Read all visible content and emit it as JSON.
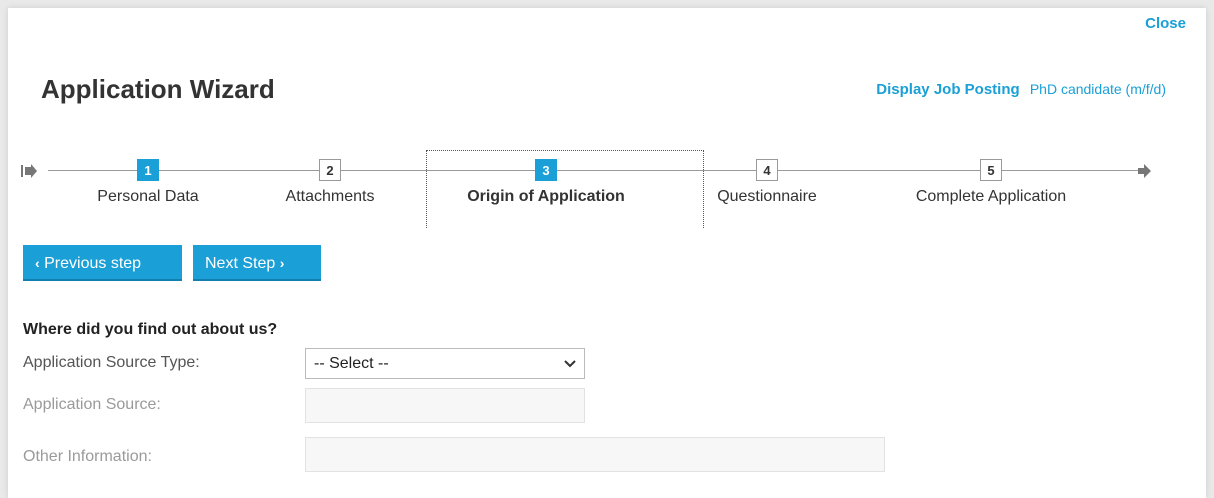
{
  "dialog": {
    "close_label": "Close",
    "title": "Application Wizard",
    "display_job_label": "Display Job Posting",
    "job_title": "PhD candidate (m/f/d)"
  },
  "wizard": {
    "current_step": 3,
    "steps": [
      {
        "number": "1",
        "label": "Personal Data",
        "state": "done"
      },
      {
        "number": "2",
        "label": "Attachments",
        "state": "pending"
      },
      {
        "number": "3",
        "label": "Origin of Application",
        "state": "active"
      },
      {
        "number": "4",
        "label": "Questionnaire",
        "state": "pending"
      },
      {
        "number": "5",
        "label": "Complete Application",
        "state": "pending"
      }
    ]
  },
  "nav": {
    "prev_label": "Previous step",
    "next_label": "Next Step"
  },
  "form": {
    "question": "Where did you find out about us?",
    "source_type_label": "Application Source Type:",
    "source_type_value": "-- Select --",
    "source_label": "Application Source:",
    "source_value": "",
    "other_label": "Other Information:",
    "other_value": ""
  },
  "colors": {
    "accent": "#1a9fd6",
    "text": "#333333",
    "disabled_text": "#9a9a9a"
  },
  "icons": {
    "start": "wizard-start-arrow-icon",
    "end": "wizard-end-arrow-icon",
    "select_caret": "chevron-down-icon",
    "prev": "chevron-left-icon",
    "next": "chevron-right-icon"
  }
}
